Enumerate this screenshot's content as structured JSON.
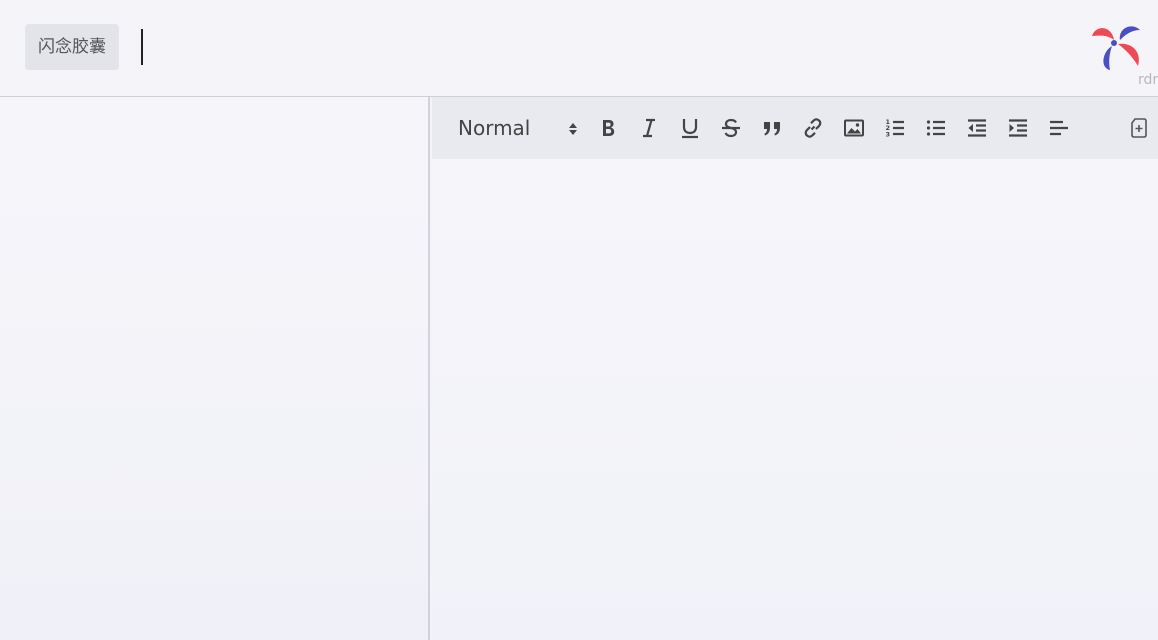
{
  "header": {
    "flash_capsule_label": "闪念胶囊",
    "logo_text": "rdr"
  },
  "editor": {
    "toolbar": {
      "heading_value": "Normal",
      "buttons": [
        "bold-icon",
        "italic-icon",
        "underline-icon",
        "strike-icon",
        "quote-icon",
        "link-icon",
        "image-icon",
        "ordered-list-icon",
        "bullet-list-icon",
        "outdent-icon",
        "indent-icon",
        "align-left-icon",
        "new-note-icon"
      ]
    }
  },
  "colors": {
    "logo_red": "#ee4a55",
    "logo_blue": "#4b4fc4",
    "toolbar_bg": "#e9e9f0",
    "icon": "#444444"
  }
}
